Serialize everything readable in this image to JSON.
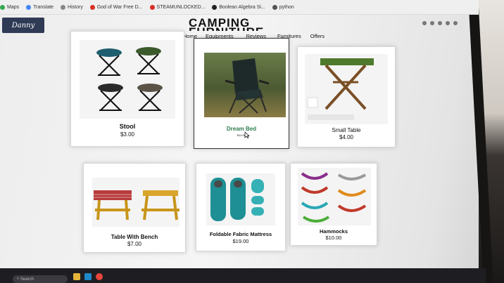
{
  "browser": {
    "bookmarks": [
      {
        "label": "Maps",
        "color": "#34a853"
      },
      {
        "label": "Translate",
        "color": "#4285f4"
      },
      {
        "label": "History",
        "color": "#888888"
      },
      {
        "label": "God of War Free D...",
        "color": "#d93025"
      },
      {
        "label": "STEAMUNLOCKED...",
        "color": "#d93025"
      },
      {
        "label": "Boolean Algebra Si...",
        "color": "#222222"
      },
      {
        "label": "python",
        "color": "#555555"
      }
    ],
    "url_fragment": "~~Company/Retail%20Camping%20Company/furniture.html"
  },
  "site": {
    "logo_text": "Danny",
    "title": "CAMPING FURNITURE",
    "nav": [
      "Home",
      "Equipments",
      "Reviews",
      "Furnitures",
      "Offers"
    ]
  },
  "products": [
    {
      "name": "Stool",
      "price": "$3.00"
    },
    {
      "name": "Dream Bed",
      "price": "$10.00"
    },
    {
      "name": "Small Table",
      "price": "$4.00"
    },
    {
      "name": "Table With Bench",
      "price": "$7.00"
    },
    {
      "name": "Foldable Fabric Mattress",
      "price": "$19.00"
    },
    {
      "name": "Hammocks",
      "price": "$10.00"
    }
  ],
  "taskbar": {
    "search_placeholder": "Search"
  },
  "colors": {
    "accent_green": "#2e7d4f",
    "logo_bg": "#2f3a55"
  }
}
